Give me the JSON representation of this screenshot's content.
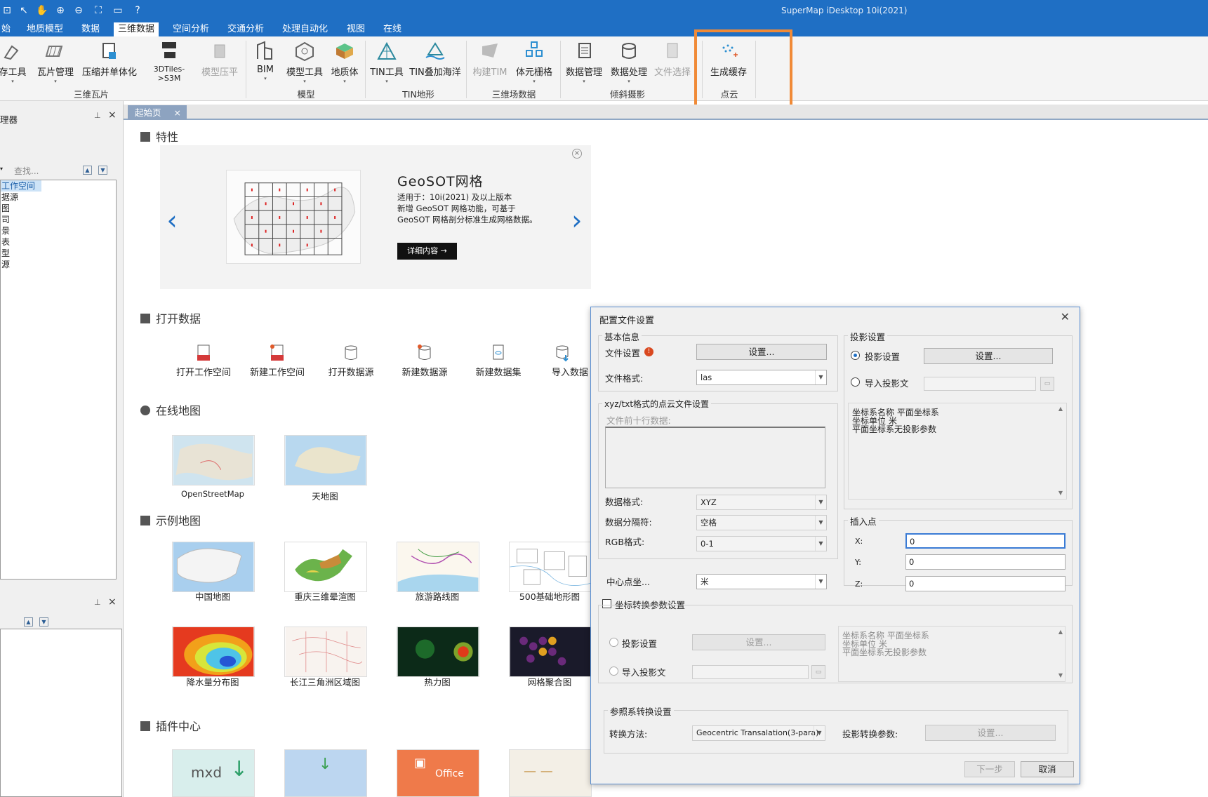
{
  "app": {
    "title": "SuperMap iDesktop 10i(2021)"
  },
  "menu": {
    "tabs": [
      "始",
      "地质模型",
      "数据",
      "三维数据",
      "空间分析",
      "交通分析",
      "处理自动化",
      "视图",
      "在线"
    ],
    "active": "三维数据"
  },
  "ribbon": {
    "buttons": {
      "tools": "存工具",
      "tile_mgr": "瓦片管理",
      "compress": "压缩并单体化",
      "tiles3d": "3DTiles->S3M",
      "model_flat": "模型压平",
      "bim": "BIM",
      "model_tools": "模型工具",
      "geo_body": "地质体",
      "tin_tools": "TIN工具",
      "tin_sea": "TIN叠加海洋",
      "build_tim": "构建TIM",
      "voxel": "体元栅格",
      "data_mgr": "数据管理",
      "data_proc": "数据处理",
      "file_sel": "文件选择",
      "gen_cache": "生成缓存"
    },
    "groups": {
      "tiles": "三维瓦片",
      "model": "模型",
      "tin": "TIN地形",
      "field": "三维场数据",
      "oblique": "倾斜摄影",
      "pointcloud": "点云"
    }
  },
  "left_panel": {
    "title": "理器",
    "search_placeholder": "查找...",
    "tree": [
      "工作空间",
      "据源",
      "图",
      "司",
      "景",
      "表",
      "型",
      "源"
    ]
  },
  "tabs": {
    "start": "起始页"
  },
  "start": {
    "features": "特性",
    "banner": {
      "title": "GeoSOT网格",
      "desc1": "适用于：10i(2021) 及以上版本",
      "desc2": "新增 GeoSOT 网格功能，可基于",
      "desc3": "GeoSOT 网格剖分标准生成网格数据。",
      "btn": "详细内容 →"
    },
    "open_data": "打开数据",
    "open_items": [
      "打开工作空间",
      "新建工作空间",
      "打开数据源",
      "新建数据源",
      "新建数据集",
      "导入数据"
    ],
    "online_map": "在线地图",
    "online_items": [
      "OpenStreetMap",
      "天地图"
    ],
    "sample_map": "示例地图",
    "sample_items": [
      "中国地图",
      "重庆三维晕渲图",
      "旅游路线图",
      "500基础地形图",
      "降水量分布图",
      "长江三角洲区域图",
      "热力图",
      "网格聚合图"
    ],
    "plugin": "插件中心",
    "plugin_items": [
      "mxd",
      "",
      "Office",
      ""
    ]
  },
  "dialog": {
    "title": "配置文件设置",
    "basic": "基本信息",
    "file_setting": "文件设置",
    "set_btn": "设置...",
    "file_format": "文件格式:",
    "file_format_val": "las",
    "xyz_group": "xyz/txt格式的点云文件设置",
    "preview_label": "文件前十行数据:",
    "data_format": "数据格式:",
    "data_format_val": "XYZ",
    "separator": "数据分隔符:",
    "separator_val": "空格",
    "rgb_format": "RGB格式:",
    "rgb_val": "0-1",
    "center_coord": "中心点坐...",
    "center_val": "米",
    "proj_group": "投影设置",
    "proj_setting": "投影设置",
    "import_proj": "导入投影文",
    "coord_info": [
      "坐标系名称        平面坐标系",
      "坐标单位            米",
      "平面坐标系无投影参数"
    ],
    "insert_group": "插入点",
    "x_label": "X:",
    "x_val": "0",
    "y_label": "Y:",
    "y_val": "0",
    "z_label": "Z:",
    "z_val": "0",
    "coord_transform": "坐标转换参数设置",
    "ref_group": "参照系转换设置",
    "transform_method": "转换方法:",
    "transform_val": "Geocentric Transalation(3-para)",
    "proj_transform_param": "投影转换参数:",
    "next_btn": "下一步",
    "cancel_btn": "取消"
  }
}
